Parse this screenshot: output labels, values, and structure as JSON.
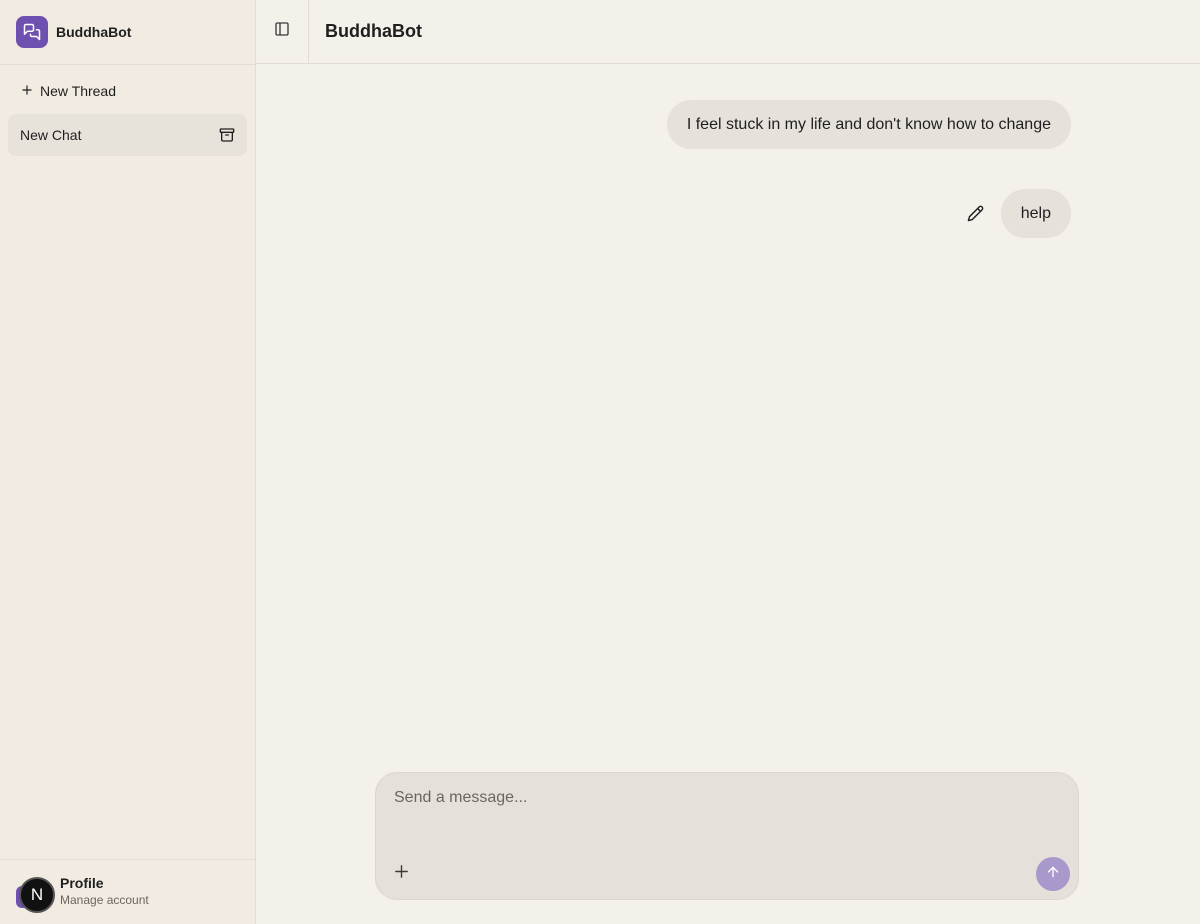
{
  "sidebar": {
    "brand_name": "BuddhaBot",
    "new_thread_label": "New Thread",
    "threads": [
      {
        "label": "New Chat"
      }
    ],
    "profile": {
      "avatar_letter": "N",
      "name": "Profile",
      "subtitle": "Manage account"
    }
  },
  "header": {
    "title": "BuddhaBot"
  },
  "messages": [
    {
      "role": "user",
      "text": "I feel stuck in my life and don't know how to change"
    },
    {
      "role": "user",
      "text": "help"
    }
  ],
  "composer": {
    "placeholder": "Send a message..."
  },
  "colors": {
    "accent": "#6e50b0",
    "send_button": "#a898cc",
    "background": "#f4f0ea",
    "sidebar": "#f1ebe2",
    "bubble": "#e6e1da"
  },
  "icons": {
    "brand": "chat-bubbles-icon",
    "new_thread": "plus-icon",
    "archive": "archive-icon",
    "sidebar_toggle": "sidebar-toggle-icon",
    "edit": "pencil-icon",
    "attach": "plus-icon",
    "send": "arrow-up-icon"
  }
}
